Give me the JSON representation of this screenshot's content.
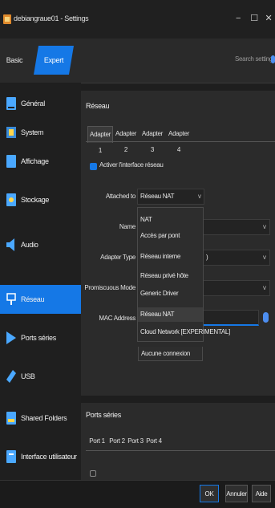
{
  "window": {
    "title": "debiangraue01 - Settings",
    "minimize": "−",
    "maximize": "☐",
    "close": "✕"
  },
  "mode_tabs": {
    "basic": "Basic",
    "expert": "Expert"
  },
  "search": {
    "placeholder": "Search settings"
  },
  "sidebar": {
    "items": [
      {
        "label": "Général",
        "icon": "monitor-icon",
        "color": "#4aa8ff"
      },
      {
        "label": "System",
        "icon": "chip-icon",
        "color": "#3a8bd8"
      },
      {
        "label": "Affichage",
        "icon": "display-icon",
        "color": "#4aa8ff"
      },
      {
        "label": "Stockage",
        "icon": "storage-icon",
        "color": "#4aa8ff"
      },
      {
        "label": "Audio",
        "icon": "speaker-icon",
        "color": "#4aa8ff"
      },
      {
        "label": "Réseau",
        "icon": "network-icon",
        "color": "#ffffff",
        "active": true
      },
      {
        "label": "Ports séries",
        "icon": "serial-port-icon",
        "color": "#4aa8ff"
      },
      {
        "label": "USB",
        "icon": "usb-icon",
        "color": "#4aa8ff"
      },
      {
        "label": "Shared Folders",
        "icon": "folder-icon",
        "color": "#4aa8ff"
      },
      {
        "label": "Interface utilisateur",
        "icon": "window-icon",
        "color": "#4aa8ff"
      }
    ]
  },
  "network": {
    "title": "Réseau",
    "tabs": [
      "Adapter 1",
      "Adapter 2",
      "Adapter 3",
      "Adapter 4"
    ],
    "enable_label": "Activer l'interface réseau",
    "attached_label": "Attached to",
    "attached_value": "Réseau NAT",
    "name_label": "Name",
    "adapter_type_label": "Adapter Type",
    "promiscuous_label": "Promiscuous Mode",
    "mac_label": "MAC Address",
    "adapter_type_tail": ")"
  },
  "dropdown": {
    "options": [
      "NAT",
      "Accès par pont",
      "Réseau interne",
      "Réseau privé hôte",
      "Generic Driver",
      "Réseau NAT",
      "Cloud Network [EXPERIMENTAL]",
      "Aucune connexion"
    ],
    "selected": "Réseau NAT"
  },
  "ports": {
    "title": "Ports séries",
    "tabs": [
      "Port 1",
      "Port 2",
      "Port 3",
      "Port 4"
    ]
  },
  "buttons": {
    "ok": "OK",
    "cancel": "Annuler",
    "help": "Aide"
  },
  "colors": {
    "accent": "#1578e6"
  }
}
